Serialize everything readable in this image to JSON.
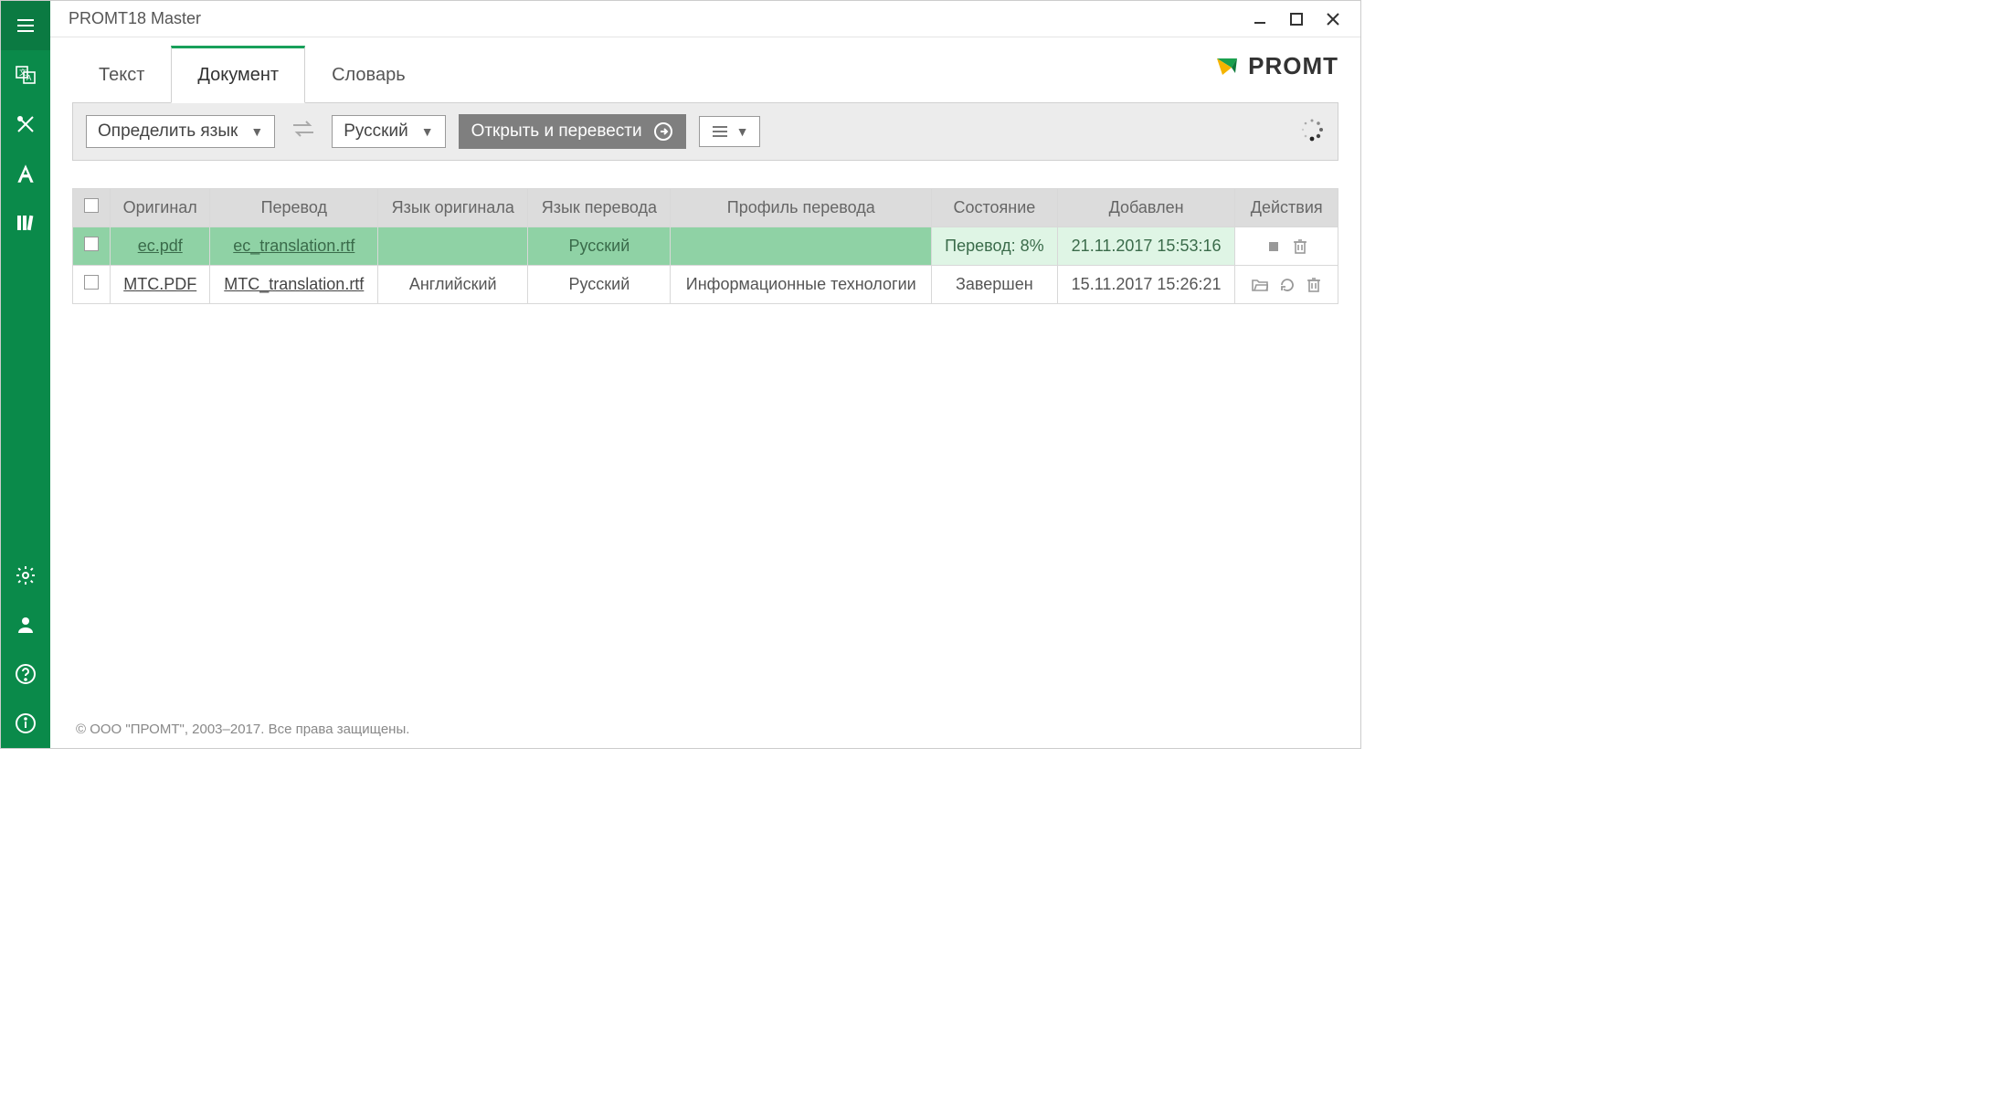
{
  "window": {
    "title": "PROMT18 Master"
  },
  "brand": {
    "text": "PROMT"
  },
  "tabs": [
    {
      "label": "Текст",
      "active": false
    },
    {
      "label": "Документ",
      "active": true
    },
    {
      "label": "Словарь",
      "active": false
    }
  ],
  "toolbar": {
    "source_lang": "Определить язык",
    "target_lang": "Русский",
    "open_translate": "Открыть и перевести"
  },
  "columns": {
    "original": "Оригинал",
    "translation": "Перевод",
    "src_lang": "Язык оригинала",
    "tgt_lang": "Язык перевода",
    "profile": "Профиль перевода",
    "status": "Состояние",
    "added": "Добавлен",
    "actions": "Действия"
  },
  "rows": [
    {
      "original": "ec.pdf",
      "translation": "ec_translation.rtf",
      "src_lang": "",
      "tgt_lang": "Русский",
      "profile": "",
      "status": "Перевод: 8%",
      "added": "21.11.2017 15:53:16",
      "active": true
    },
    {
      "original": "MTC.PDF",
      "translation": "MTC_translation.rtf",
      "src_lang": "Английский",
      "tgt_lang": "Русский",
      "profile": "Информационные технологии",
      "status": "Завершен",
      "added": "15.11.2017 15:26:21",
      "active": false
    }
  ],
  "footer": {
    "copyright": "© ООО \"ПРОМТ\", 2003–2017. Все права защищены."
  }
}
